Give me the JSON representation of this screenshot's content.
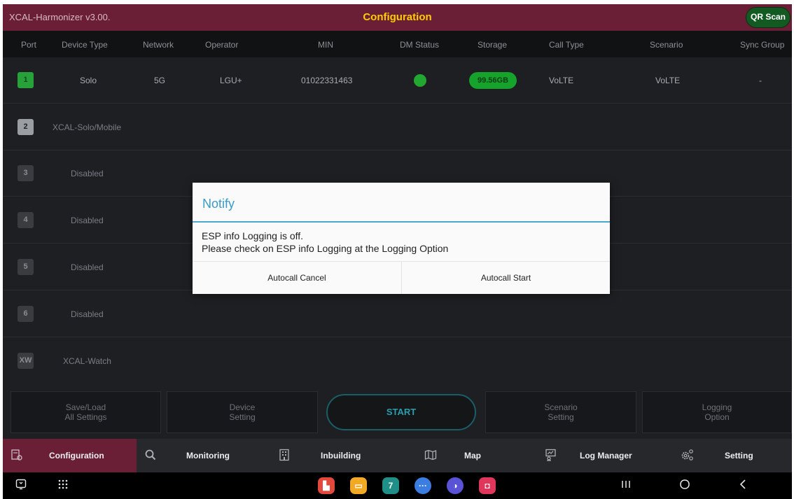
{
  "titlebar": {
    "app_title": "XCAL-Harmonizer v3.00.",
    "page_title": "Configuration",
    "qr_button": "QR Scan"
  },
  "table": {
    "columns": [
      "Port",
      "Device Type",
      "Network",
      "Operator",
      "MIN",
      "DM Status",
      "Storage",
      "Call Type",
      "Scenario",
      "Sync Group"
    ],
    "rows": [
      {
        "port": "1",
        "device_type": "Solo",
        "network": "5G",
        "operator": "LGU+",
        "min": "01022331463",
        "dm_status": "connected",
        "storage": "99.56GB",
        "call_type": "VoLTE",
        "scenario": "VoLTE",
        "sync_group": "-"
      },
      {
        "port": "2",
        "device_type": "XCAL-Solo/Mobile"
      },
      {
        "port": "3",
        "device_type": "Disabled"
      },
      {
        "port": "4",
        "device_type": "Disabled"
      },
      {
        "port": "5",
        "device_type": "Disabled"
      },
      {
        "port": "6",
        "device_type": "Disabled"
      },
      {
        "port": "XW",
        "device_type": "XCAL-Watch"
      }
    ]
  },
  "actions": {
    "save_load_line1": "Save/Load",
    "save_load_line2": "All Settings",
    "device_line1": "Device",
    "device_line2": "Setting",
    "start": "START",
    "scenario_line1": "Scenario",
    "scenario_line2": "Setting",
    "logging_line1": "Logging",
    "logging_line2": "Option"
  },
  "tabs": [
    {
      "label": "Configuration",
      "icon": "configuration-icon",
      "active": true
    },
    {
      "label": "Monitoring",
      "icon": "search-icon"
    },
    {
      "label": "Inbuilding",
      "icon": "building-icon"
    },
    {
      "label": "Map",
      "icon": "map-icon"
    },
    {
      "label": "Log Manager",
      "icon": "log-manager-icon"
    },
    {
      "label": "Setting",
      "icon": "gear-icon"
    }
  ],
  "dialog": {
    "title": "Notify",
    "message_line1": "ESP info Logging is off.",
    "message_line2": "Please check on ESP info Logging at the Logging Option",
    "cancel": "Autocall Cancel",
    "start": "Autocall Start"
  },
  "colors": {
    "accent": "#6a1f36",
    "title_text": "#ffcc00",
    "status_green": "#22a830",
    "dialog_accent": "#49a7cc"
  }
}
